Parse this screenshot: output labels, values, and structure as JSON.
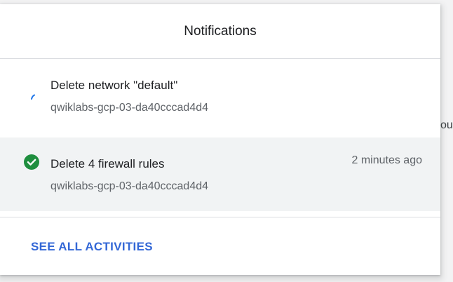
{
  "background": {
    "edge_text": "ou"
  },
  "panel": {
    "title": "Notifications",
    "notifications": [
      {
        "status": "in-progress",
        "title": "Delete network \"default\"",
        "project": "qwiklabs-gcp-03-da40cccad4d4",
        "time": ""
      },
      {
        "status": "success",
        "title": "Delete 4 firewall rules",
        "project": "qwiklabs-gcp-03-da40cccad4d4",
        "time": "2 minutes ago"
      }
    ],
    "footer_link": "SEE ALL ACTIVITIES"
  },
  "colors": {
    "accent": "#3367d6",
    "success": "#1e8e3e",
    "progress": "#1a73e8"
  }
}
